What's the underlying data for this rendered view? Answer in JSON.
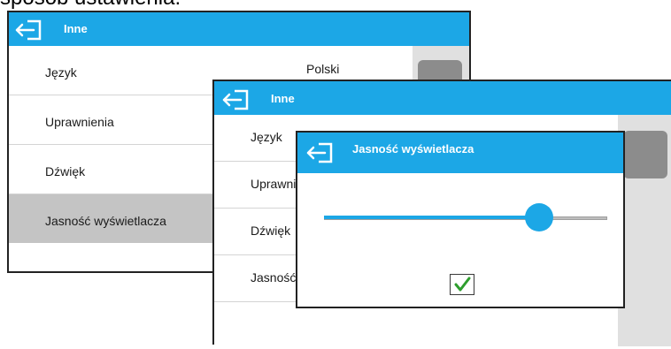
{
  "heading_fragment": "sposób ustawienia:",
  "window_back": {
    "title": "Inne",
    "items": [
      {
        "label": "Język",
        "value": "Polski"
      },
      {
        "label": "Uprawnienia"
      },
      {
        "label": "Dźwięk"
      },
      {
        "label": "Jasność wyświetlacza",
        "selected": true
      }
    ]
  },
  "window_middle": {
    "title": "Inne",
    "items": [
      {
        "label": "Język"
      },
      {
        "label": "Uprawnienia"
      },
      {
        "label": "Dźwięk"
      },
      {
        "label": "Jasność wyświetlacza"
      },
      {
        "label": ""
      }
    ]
  },
  "dialog": {
    "title": "Jasność wyświetlacza",
    "brightness_fraction": 0.76,
    "confirm_glyph": "✓"
  },
  "colors": {
    "accent": "#1ca7e6",
    "selected_row": "#c4c4c4",
    "scrollbar_thumb": "#8c8c8c",
    "confirm_check": "#2e9e2e"
  },
  "icons": {
    "back": "exit-arrow-icon",
    "confirm": "checkmark-icon"
  }
}
